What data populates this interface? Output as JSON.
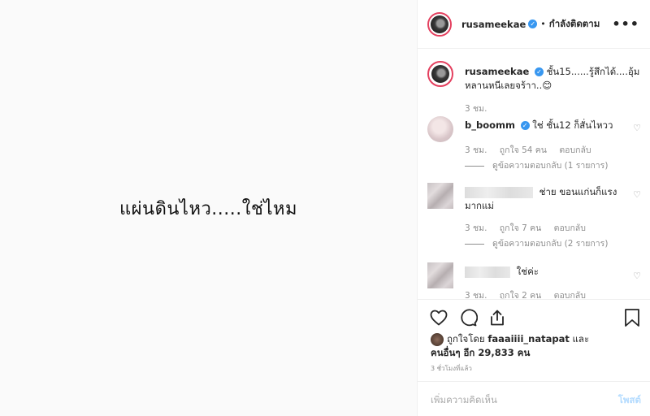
{
  "post": {
    "image_caption": "แผ่นดินไหว.....ใช่ไหม"
  },
  "header": {
    "username": "rusameekae",
    "separator": "•",
    "follow_state": "กำลังติดตาม",
    "more_label": "•••"
  },
  "caption": {
    "username": "rusameekae",
    "text": "ชั้น15......รู้สึกได้....อุ้มหลานหนีเลยจร้าา..😊",
    "time": "3 ชม."
  },
  "comments": [
    {
      "username": "b_boomm",
      "text": "ใช่ ชั้น12 ก็สั่นไหวว",
      "time": "3 ชม.",
      "likes": "ถูกใจ 54 คน",
      "reply": "ตอบกลับ",
      "view_replies": "ดูข้อความตอบกลับ (1 รายการ)"
    },
    {
      "username": "",
      "text": "ช่าย ขอนแก่นก็แรงมากแม่",
      "time": "3 ชม.",
      "likes": "ถูกใจ 7 คน",
      "reply": "ตอบกลับ",
      "view_replies": "ดูข้อความตอบกลับ (2 รายการ)"
    },
    {
      "username": "",
      "text": "ใช่ค่ะ",
      "time": "3 ชม.",
      "likes": "ถูกใจ 2 คน",
      "reply": "ตอบกลับ"
    }
  ],
  "likes": {
    "prefix": "ถูกใจโดย",
    "user": "faaaiiii_natapat",
    "and": "และ",
    "others": "คนอื่นๆ อีก 29,833 คน"
  },
  "time_ago": "3 ชั่วโมงที่แล้ว",
  "add_comment": {
    "placeholder": "เพิ่มความคิดเห็น",
    "post_label": "โพสต์"
  },
  "colors": {
    "verified": "#3897f0",
    "post_button_disabled": "#b3dbff",
    "story_ring": "#e4405f"
  }
}
